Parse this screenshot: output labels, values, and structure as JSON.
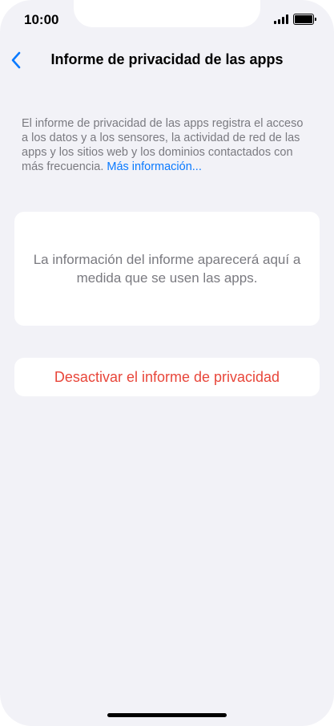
{
  "status_bar": {
    "time": "10:00"
  },
  "nav": {
    "back_icon": "chevron-left-icon",
    "title": "Informe de privacidad de las apps"
  },
  "description": {
    "text": "El informe de privacidad de las apps registra el acceso a los datos y a los sensores, la actividad de red de las apps y los sitios web y los dominios contactados con más frecuencia.",
    "link_label": "Más información..."
  },
  "info_card": {
    "text": "La información del informe aparecerá aquí a medida que se usen las apps."
  },
  "action": {
    "label": "Desactivar el informe de privacidad"
  },
  "colors": {
    "background": "#f2f2f7",
    "link": "#0a7aff",
    "destructive": "#e8463a",
    "secondary_text": "#7a7a80"
  }
}
